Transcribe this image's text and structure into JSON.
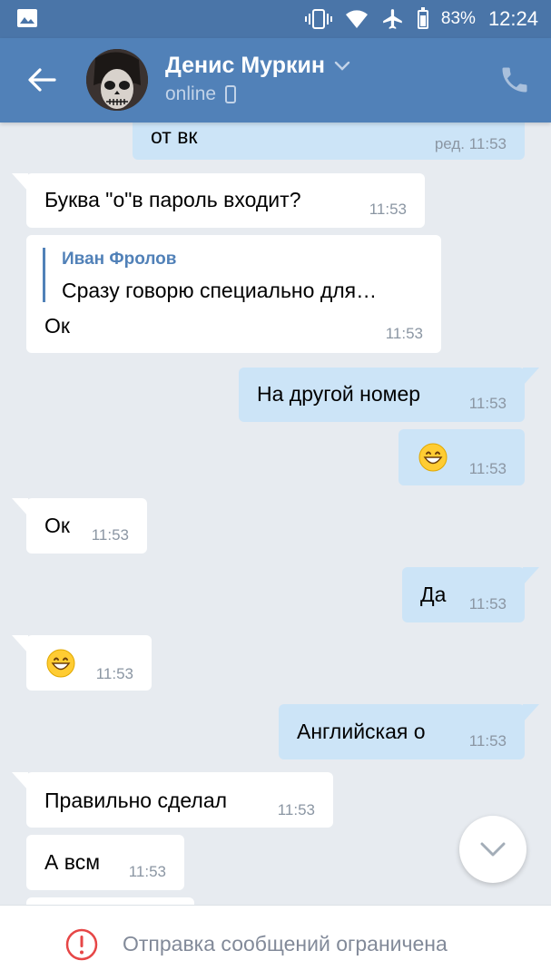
{
  "status_bar": {
    "battery": "83%",
    "time": "12:24"
  },
  "header": {
    "contact_name": "Денис Муркин",
    "status": "online"
  },
  "messages": [
    {
      "dir": "out",
      "text": "от вк",
      "time": "ред. 11:53"
    },
    {
      "dir": "in",
      "text": "Буква \"о\"в пароль входит?",
      "time": "11:53"
    },
    {
      "dir": "in",
      "reply_author": "Иван Фролов",
      "reply_text": "Сразу говорю специально для…",
      "text": "Ок",
      "time": "11:53"
    },
    {
      "dir": "out",
      "text": "На другой номер",
      "time": "11:53"
    },
    {
      "dir": "out",
      "emoji": "grinning-face",
      "time": "11:53"
    },
    {
      "dir": "in",
      "text": "Ок",
      "time": "11:53"
    },
    {
      "dir": "out",
      "text": "Да",
      "time": "11:53"
    },
    {
      "dir": "in",
      "emoji": "grinning-face",
      "time": "11:53"
    },
    {
      "dir": "out",
      "text": "Английская о",
      "time": "11:53"
    },
    {
      "dir": "in",
      "text": "Правильно сделал",
      "time": "11:53"
    },
    {
      "dir": "in",
      "text": "А всм",
      "time": "11:53"
    }
  ],
  "footer": {
    "notice": "Отправка сообщений ограничена"
  },
  "colors": {
    "header": "#5181b8",
    "status_bar": "#4a75a8",
    "incoming_bubble": "#ffffff",
    "outgoing_bubble": "#cce4f7",
    "background": "#e7ebf0",
    "reply_accent": "#5181b8",
    "alert": "#e64646"
  }
}
